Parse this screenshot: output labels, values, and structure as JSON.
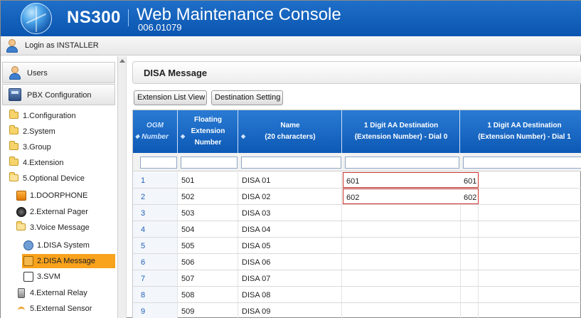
{
  "header": {
    "product": "NS300",
    "console_title": "Web Maintenance Console",
    "version": "006.01079"
  },
  "login": {
    "text": "Login as INSTALLER"
  },
  "sidebar": {
    "users_label": "Users",
    "pbx_label": "PBX Configuration",
    "tree": [
      {
        "label": "1.Configuration",
        "icon": "folder-icon"
      },
      {
        "label": "2.System",
        "icon": "folder-icon"
      },
      {
        "label": "3.Group",
        "icon": "folder-icon"
      },
      {
        "label": "4.Extension",
        "icon": "folder-icon"
      },
      {
        "label": "5.Optional Device",
        "icon": "folder-open-icon"
      },
      {
        "label": "1.DOORPHONE",
        "icon": "doorphone-icon"
      },
      {
        "label": "2.External Pager",
        "icon": "pager-icon"
      },
      {
        "label": "3.Voice Message",
        "icon": "folder-open-icon"
      },
      {
        "label": "1.DISA System",
        "icon": "disa-system-icon"
      },
      {
        "label": "2.DISA Message",
        "icon": "disa-message-icon",
        "selected": true
      },
      {
        "label": "3.SVM",
        "icon": "svm-icon"
      },
      {
        "label": "4.External Relay",
        "icon": "relay-icon"
      },
      {
        "label": "5.External Sensor",
        "icon": "sensor-icon"
      }
    ]
  },
  "main": {
    "title": "DISA Message",
    "buttons": {
      "extension_list_view": "Extension List View",
      "destination_setting": "Destination Setting"
    },
    "table": {
      "headers": {
        "ogm_line1": "OGM",
        "ogm_line2": "Number",
        "floating_line1": "Floating",
        "floating_line2": "Extension",
        "floating_line3": "Number",
        "name_line1": "Name",
        "name_line2": "(20 characters)",
        "dial0_line1": "1 Digit AA Destination",
        "dial0_line2": "(Extension Number) - Dial 0",
        "dial1_line1": "1 Digit AA Destination",
        "dial1_line2": "(Extension Number) - Dial 1"
      },
      "rows": [
        {
          "ogm": "1",
          "floating": "501",
          "name": "DISA 01",
          "dial0": "601",
          "dial1": "601"
        },
        {
          "ogm": "2",
          "floating": "502",
          "name": "DISA 02",
          "dial0": "602",
          "dial1": "602"
        },
        {
          "ogm": "3",
          "floating": "503",
          "name": "DISA 03",
          "dial0": "",
          "dial1": ""
        },
        {
          "ogm": "4",
          "floating": "504",
          "name": "DISA 04",
          "dial0": "",
          "dial1": ""
        },
        {
          "ogm": "5",
          "floating": "505",
          "name": "DISA 05",
          "dial0": "",
          "dial1": ""
        },
        {
          "ogm": "6",
          "floating": "506",
          "name": "DISA 06",
          "dial0": "",
          "dial1": ""
        },
        {
          "ogm": "7",
          "floating": "507",
          "name": "DISA 07",
          "dial0": "",
          "dial1": ""
        },
        {
          "ogm": "8",
          "floating": "508",
          "name": "DISA 08",
          "dial0": "",
          "dial1": ""
        },
        {
          "ogm": "9",
          "floating": "509",
          "name": "DISA 09",
          "dial0": "",
          "dial1": ""
        }
      ]
    }
  }
}
